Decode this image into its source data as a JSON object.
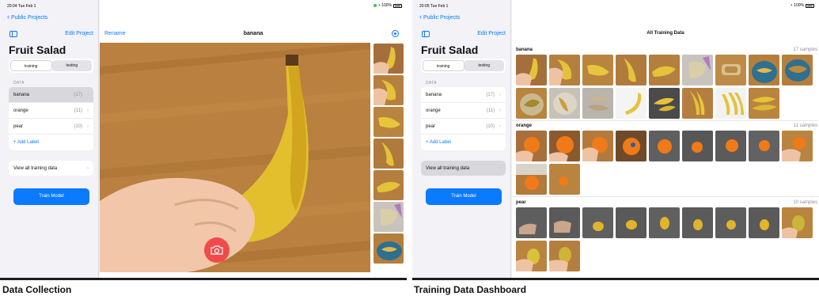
{
  "left": {
    "caption": "Data Collection",
    "status_time": "20:04  Tue Feb 1",
    "status_battery": "100%",
    "back_label": "Public Projects",
    "edit_label": "Edit Project",
    "project_title": "Fruit Salad",
    "segments": [
      "training",
      "testing"
    ],
    "data_header": "DATA",
    "labels": [
      {
        "name": "banana",
        "count": "(17)"
      },
      {
        "name": "orange",
        "count": "(11)"
      },
      {
        "name": "pear",
        "count": "(10)"
      }
    ],
    "add_label": "+ Add Label",
    "view_all": "View all training data",
    "train_button": "Train Model",
    "rename_label": "Rename",
    "label_title": "banana"
  },
  "right": {
    "caption": "Training Data Dashboard",
    "status_time": "20:05  Tue Feb 1",
    "status_battery": "100%",
    "back_label": "Public Projects",
    "edit_label": "Edit Project",
    "project_title": "Fruit Salad",
    "segments": [
      "training",
      "testing"
    ],
    "data_header": "DATA",
    "labels": [
      {
        "name": "banana",
        "count": "(17)"
      },
      {
        "name": "orange",
        "count": "(11)"
      },
      {
        "name": "pear",
        "count": "(10)"
      }
    ],
    "add_label": "+ Add Label",
    "view_all": "View all training data",
    "train_button": "Train Model",
    "dash_title": "All Training Data",
    "groups": [
      {
        "name": "banana",
        "samples": "17 samples"
      },
      {
        "name": "orange",
        "samples": "11 samples"
      },
      {
        "name": "pear",
        "samples": "10 samples"
      }
    ]
  },
  "colors": {
    "accent": "#0a7aff",
    "camera": "#f04a4a",
    "banana": "#e8c33a",
    "orange": "#f07a18",
    "pear": "#c9b53a"
  },
  "icons": [
    "chevron-left-icon",
    "sidebar-toggle-icon",
    "info-icon",
    "camera-icon",
    "chevron-right-icon",
    "wifi-icon",
    "battery-icon"
  ]
}
